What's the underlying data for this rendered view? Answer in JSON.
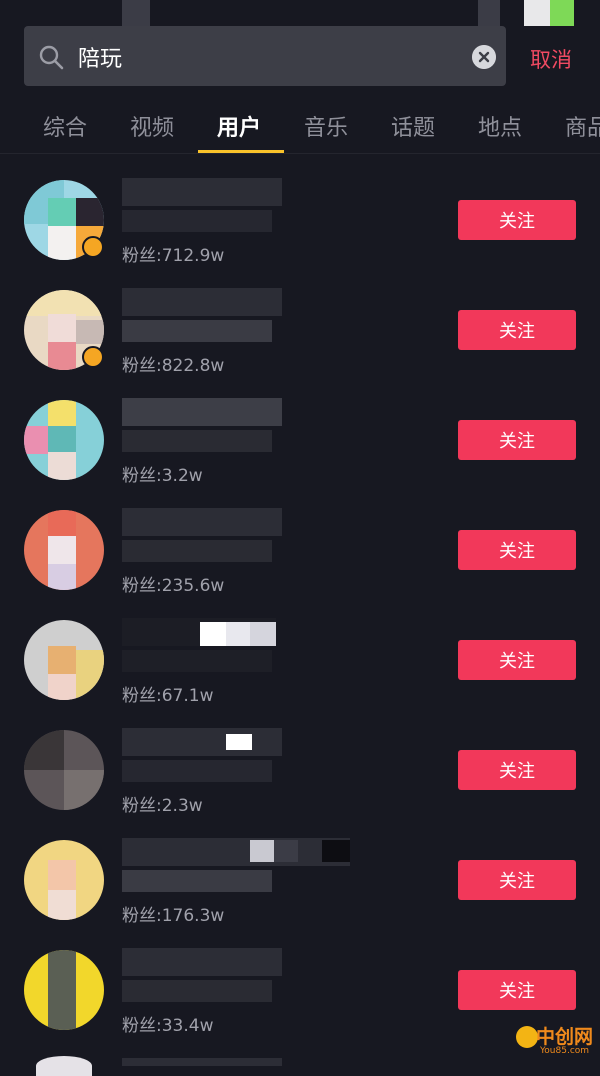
{
  "search": {
    "query": "陪玩",
    "cancel_label": "取消"
  },
  "tabs": [
    {
      "label": "综合"
    },
    {
      "label": "视频"
    },
    {
      "label": "用户",
      "active": true
    },
    {
      "label": "音乐"
    },
    {
      "label": "话题"
    },
    {
      "label": "地点"
    },
    {
      "label": "商品"
    }
  ],
  "follow_label": "关注",
  "users": [
    {
      "fans": "粉丝:712.9w",
      "verified": true
    },
    {
      "fans": "粉丝:822.8w",
      "verified": true
    },
    {
      "fans": "粉丝:3.2w",
      "verified": false
    },
    {
      "fans": "粉丝:235.6w",
      "verified": false
    },
    {
      "fans": "粉丝:67.1w",
      "verified": false
    },
    {
      "fans": "粉丝:2.3w",
      "verified": false
    },
    {
      "fans": "粉丝:176.3w",
      "verified": false
    },
    {
      "fans": "粉丝:33.4w",
      "verified": false
    }
  ],
  "watermark": {
    "title": "中创网",
    "subtitle": "You85.com"
  },
  "colors": {
    "accent_red": "#f2385a",
    "tab_indicator": "#f9c22a",
    "badge": "#f5a623"
  }
}
